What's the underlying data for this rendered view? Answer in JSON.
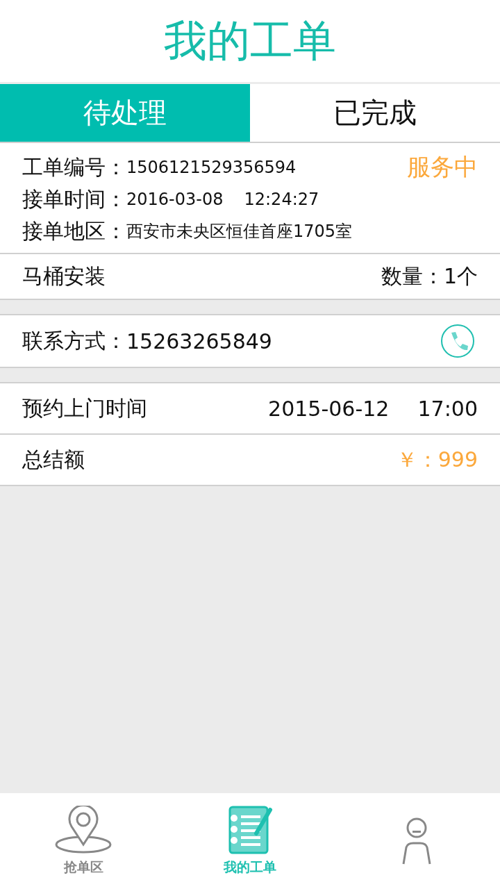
{
  "header": {
    "title": "我的工单"
  },
  "tabs": [
    {
      "label": "待处理",
      "selected": true
    },
    {
      "label": "已完成",
      "selected": false
    }
  ],
  "order": {
    "number_label": "工单编号：",
    "number": "1506121529356594",
    "status": "服务中",
    "time_label": "接单时间：",
    "date": "2016-03-08",
    "time": "12:24:27",
    "area_label": "接单地区：",
    "area": "西安市未央区恒佳首座1705室"
  },
  "product": {
    "name": "马桶安装",
    "quantity": "数量：1个"
  },
  "contact": {
    "label": "联系方式：",
    "phone": "15263265849"
  },
  "appointment": {
    "label": "预约上门时间",
    "date": "2015-06-12",
    "time": "17:00"
  },
  "total": {
    "label": "总结额",
    "amount": "￥：999"
  },
  "nav": [
    {
      "kind": "map",
      "label": "抢单区",
      "selected": false
    },
    {
      "kind": "notebook",
      "label": "我的工单",
      "selected": true
    },
    {
      "kind": "person",
      "selected": false
    }
  ]
}
